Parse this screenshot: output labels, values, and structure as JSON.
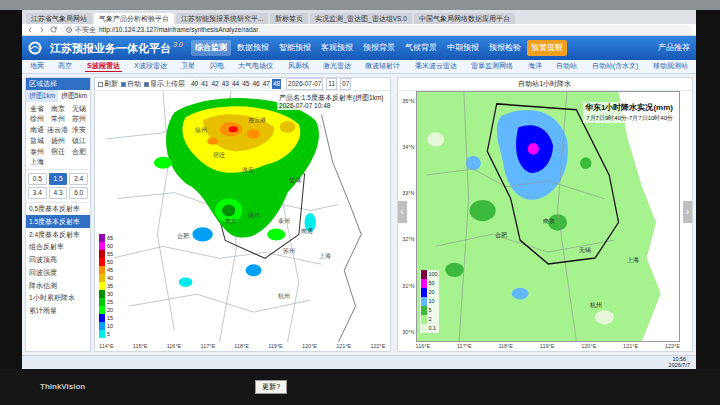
{
  "browser": {
    "tabs": [
      {
        "label": "江苏省气象局网站",
        "selected": false
      },
      {
        "label": "气象产品分析检验平台",
        "selected": true
      },
      {
        "label": "江苏智能预报系统研究平...",
        "selected": false
      },
      {
        "label": "新标签页",
        "selected": false
      },
      {
        "label": "实况监测_雷达图_雷达组VS.0",
        "selected": false
      },
      {
        "label": "中国气象局网络数据应用平台",
        "selected": false
      }
    ],
    "security": "不安全",
    "url": "http://10.124.23.127/mainframe/synthesisAnalyze/radar"
  },
  "app": {
    "title": "江苏预报业务一体化平台",
    "version": "3.0",
    "nav": [
      {
        "label": "综合监测",
        "selected": true,
        "kind": "tab"
      },
      {
        "label": "数据预报",
        "selected": false,
        "kind": "tab"
      },
      {
        "label": "智能预报",
        "selected": false,
        "kind": "tab"
      },
      {
        "label": "客观预报",
        "selected": false,
        "kind": "tab"
      },
      {
        "label": "预报背景",
        "selected": false,
        "kind": "tab"
      },
      {
        "label": "气候背景",
        "selected": false,
        "kind": "tab"
      },
      {
        "label": "中期预报",
        "selected": false,
        "kind": "tab"
      },
      {
        "label": "预报检验",
        "selected": false,
        "kind": "tab"
      },
      {
        "label": "预警提醒",
        "selected": false,
        "kind": "alert"
      }
    ],
    "product_link": "产品推荐"
  },
  "subnav": [
    {
      "label": "地面",
      "selected": false
    },
    {
      "label": "高空",
      "selected": false
    },
    {
      "label": "S波段雷达",
      "selected": true
    },
    {
      "label": "X波段雷达",
      "selected": false
    },
    {
      "label": "卫星",
      "selected": false
    },
    {
      "label": "闪电",
      "selected": false
    },
    {
      "label": "大气电场仪",
      "selected": false
    },
    {
      "label": "风廓线",
      "selected": false
    },
    {
      "label": "激光雷达",
      "selected": false
    },
    {
      "label": "微波辐射计",
      "selected": false
    },
    {
      "label": "毫米波云雷达",
      "selected": false
    },
    {
      "label": "雷暴监测网络",
      "selected": false
    },
    {
      "label": "海洋",
      "selected": false
    },
    {
      "label": "自动站",
      "selected": false
    },
    {
      "label": "自动站(含水文)",
      "selected": false
    },
    {
      "label": "移动观测站",
      "selected": false
    }
  ],
  "sidebar": {
    "header": "区域选择",
    "tabs": [
      {
        "label": "拼图1km",
        "selected": true
      },
      {
        "label": "拼图5km",
        "selected": false
      }
    ],
    "regions": [
      {
        "label": "全省",
        "selected": false
      },
      {
        "label": "南京",
        "selected": false
      },
      {
        "label": "无锡",
        "selected": false
      },
      {
        "label": "徐州",
        "selected": false
      },
      {
        "label": "常州",
        "selected": false
      },
      {
        "label": "苏州",
        "selected": false
      },
      {
        "label": "南通",
        "selected": false
      },
      {
        "label": "连云港",
        "selected": false
      },
      {
        "label": "淮安",
        "selected": false
      },
      {
        "label": "盐城",
        "selected": false
      },
      {
        "label": "扬州",
        "selected": false
      },
      {
        "label": "镇江",
        "selected": false
      },
      {
        "label": "泰州",
        "selected": false
      },
      {
        "label": "宿迁",
        "selected": false
      },
      {
        "label": "合肥",
        "selected": false
      },
      {
        "label": "上海",
        "selected": false
      }
    ],
    "levels": [
      {
        "label": "0.5",
        "selected": false
      },
      {
        "label": "1.5",
        "selected": true
      },
      {
        "label": "2.4",
        "selected": false
      },
      {
        "label": "3.4",
        "selected": false
      },
      {
        "label": "4.3",
        "selected": false
      },
      {
        "label": "6.0",
        "selected": false
      }
    ],
    "products": [
      {
        "label": "0.5度基本反射率",
        "selected": false
      },
      {
        "label": "1.5度基本反射率",
        "selected": true
      },
      {
        "label": "2.4度基本反射率",
        "selected": false
      },
      {
        "label": "组合反射率",
        "selected": false
      },
      {
        "label": "回波顶高",
        "selected": false
      },
      {
        "label": "回波强度",
        "selected": false
      },
      {
        "label": "降水估测",
        "selected": false
      },
      {
        "label": "1小时累积降水",
        "selected": false
      },
      {
        "label": "累计雨量",
        "selected": false
      }
    ]
  },
  "radar": {
    "controls": [
      {
        "label": "刷新",
        "checked": false
      },
      {
        "label": "自动",
        "checked": true
      },
      {
        "label": "显示上传层",
        "checked": true
      }
    ],
    "steps": [
      {
        "label": "40",
        "selected": false
      },
      {
        "label": "41",
        "selected": false
      },
      {
        "label": "42",
        "selected": false
      },
      {
        "label": "43",
        "selected": false
      },
      {
        "label": "44",
        "selected": false
      },
      {
        "label": "45",
        "selected": false
      },
      {
        "label": "46",
        "selected": false
      },
      {
        "label": "47",
        "selected": false
      },
      {
        "label": "48",
        "selected": true
      }
    ],
    "date": "2026-07-07",
    "hour": "11",
    "minute": "07",
    "title": "产品名:1.5度基本反射率(拼图1km)",
    "time": "2026-07-07 10:48",
    "colorbar": [
      {
        "label": "65",
        "color": "#9600b4"
      },
      {
        "label": "60",
        "color": "#ff00f0"
      },
      {
        "label": "55",
        "color": "#c00000"
      },
      {
        "label": "50",
        "color": "#ff0000"
      },
      {
        "label": "45",
        "color": "#ff9000"
      },
      {
        "label": "40",
        "color": "#e7c000"
      },
      {
        "label": "35",
        "color": "#ffff00"
      },
      {
        "label": "30",
        "color": "#009000"
      },
      {
        "label": "25",
        "color": "#00c800"
      },
      {
        "label": "20",
        "color": "#00ff00"
      },
      {
        "label": "15",
        "color": "#0000f6"
      },
      {
        "label": "10",
        "color": "#01a0f6"
      },
      {
        "label": "5",
        "color": "#00ecec"
      }
    ],
    "lon": [
      "114°E",
      "115°E",
      "116°E",
      "117°E",
      "118°E",
      "119°E",
      "120°E",
      "121°E",
      "122°E"
    ],
    "cities": [
      "徐州",
      "连云港",
      "宿迁",
      "淮安",
      "盐城",
      "南京",
      "扬州",
      "泰州",
      "南通",
      "合肥",
      "苏州",
      "上海",
      "杭州"
    ]
  },
  "rain": {
    "header": "自动站1小时降水",
    "title": "华东1小时降水实况(mm)",
    "period": "7月7日9时40分-7月7日10时40分",
    "legend": [
      {
        "label": "100",
        "color": "#800040"
      },
      {
        "label": "50",
        "color": "#fa00fa"
      },
      {
        "label": "20",
        "color": "#0000fe"
      },
      {
        "label": "10",
        "color": "#61b8ff"
      },
      {
        "label": "5",
        "color": "#3dba3d"
      },
      {
        "label": "2",
        "color": "#a6f28f"
      },
      {
        "label": "0.1",
        "color": "#e6f7d9"
      }
    ],
    "lat": [
      "35°N",
      "34°N",
      "33°N",
      "32°N",
      "31°N",
      "30°N"
    ],
    "lon": [
      "116°E",
      "117°E",
      "118°E",
      "119°E",
      "120°E",
      "121°E",
      "122°E"
    ],
    "cities": [
      "南京",
      "合肥",
      "无锡",
      "上海",
      "杭州"
    ]
  },
  "arrows": {
    "prev": "‹",
    "next": "›"
  },
  "taskbar": {
    "time": "10:56",
    "date": "2026/7/7"
  },
  "monitor": {
    "brand": "ThinkVision",
    "sticker": "更新?"
  }
}
